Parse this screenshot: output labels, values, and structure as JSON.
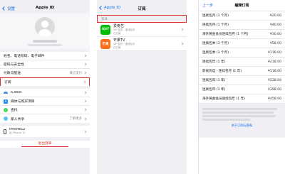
{
  "screen1": {
    "back": "设置",
    "title": "Apple ID",
    "group1": [
      {
        "label": "姓名、电话号码、电子邮件"
      },
      {
        "label": "密码与安全性"
      },
      {
        "label": "付款与配送",
        "value": "微信支付"
      },
      {
        "label": "订阅"
      }
    ],
    "group2": [
      {
        "label": "iCloud",
        "icon": "icloud-icon"
      },
      {
        "label": "媒体与购买项目",
        "icon": "app-store-icon"
      },
      {
        "label": "查找",
        "icon": "find-my-icon"
      },
      {
        "label": "家人共享",
        "value": "了解更多",
        "icon": "family-sharing-icon"
      }
    ],
    "device": {
      "name": "iPhone12",
      "sub": "此 iPhone 12"
    },
    "logout": "退出登录"
  },
  "screen2": {
    "back": "Apple ID",
    "title": "订阅",
    "section": "有效",
    "apps": [
      {
        "name": "爱奇艺",
        "icon_text": "iQIY",
        "detail": "VIP 会员 · 连续包月",
        "sub": "已订阅"
      },
      {
        "name": "芒果TV",
        "icon_text": "芒果",
        "detail": "VIP 会员 · 连续包月",
        "sub": "已订阅"
      }
    ]
  },
  "screen3": {
    "back": "上一步",
    "title": "编辑订阅",
    "options": [
      {
        "label": "连续包月 (1 个月)",
        "price": "¥20.00"
      },
      {
        "label": "连续包月 (1 个月)",
        "price": "¥40.00"
      },
      {
        "label": "海外黄金会员连续包月 (1 个月)",
        "price": "¥30.00"
      },
      {
        "label": "连续包季 (3 个月)",
        "price": "¥58.00"
      },
      {
        "label": "连续包季 (3 个月)",
        "price": "¥118.00"
      },
      {
        "label": "连续包年 (1 年)",
        "price": "¥218.00"
      },
      {
        "label": "影视优选 · 连续包月 (1 年)",
        "price": "¥218.00"
      },
      {
        "label": "连续包年 (1 年)",
        "price": "¥228.00"
      },
      {
        "label": "连续包年 (1 年)",
        "price": "¥398.00"
      },
      {
        "label": "海外黄金会员连续包年 (1 年)",
        "price": "¥458.00"
      }
    ],
    "link": "关于订阅与隐私"
  }
}
